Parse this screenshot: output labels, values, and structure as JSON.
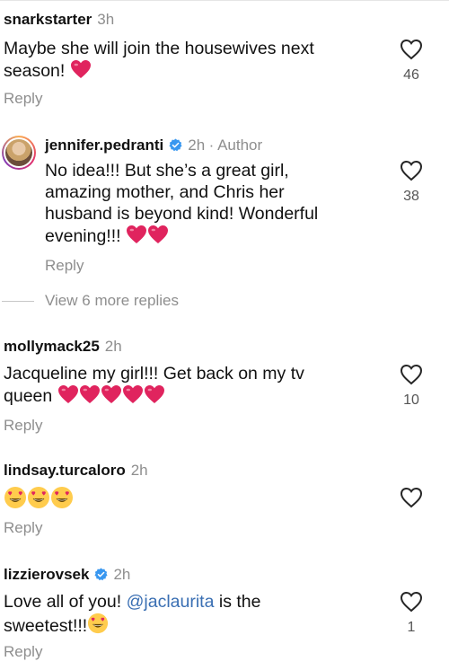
{
  "comments": [
    {
      "username": "snarkstarter",
      "time": "3h",
      "text_lines": [
        "Maybe she will join the housewives next",
        "season!"
      ],
      "likes": "46",
      "reply_label": "Reply"
    },
    {
      "username": "jennifer.pedranti",
      "time": "2h",
      "author_label": "· Author",
      "text_lines": [
        "No idea!!! But she’s a great girl,",
        "amazing mother, and Chris her",
        "husband is beyond kind! Wonderful",
        "evening!!!"
      ],
      "likes": "38",
      "reply_label": "Reply",
      "view_more": "View 6 more replies"
    },
    {
      "username": "mollymack25",
      "time": "2h",
      "text_lines": [
        "Jacqueline my girl!!! Get back on my tv",
        "queen"
      ],
      "likes": "10",
      "reply_label": "Reply"
    },
    {
      "username": "lindsay.turcaloro",
      "time": "2h",
      "text_lines": [
        ""
      ],
      "likes": "",
      "reply_label": "Reply"
    },
    {
      "username": "lizzierovsek",
      "time": "2h",
      "text_pre": "Love all of you!",
      "mention": "@jaclaurita",
      "text_post": " is the",
      "text_line2": "sweetest!!!",
      "likes": "1",
      "reply_label": "Reply"
    }
  ],
  "colors": {
    "heart_red": "#e0245e",
    "verified_blue": "#3897f0",
    "mention_blue": "#3a6fb3",
    "meta_gray": "#8e8e8e"
  },
  "icons": [
    "heart-outline-icon",
    "red-heart-emoji",
    "heart-eyes-emoji",
    "verified-badge-icon"
  ]
}
